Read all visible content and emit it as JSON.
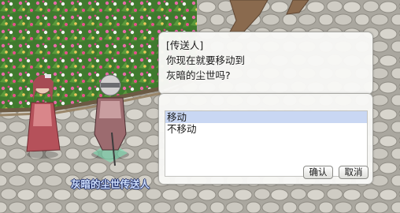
{
  "dialog": {
    "message_text": "[传送人]\n你现在就要移动到\n灰暗的尘世吗?",
    "options": [
      {
        "label": "移动",
        "selected": true
      },
      {
        "label": "不移动",
        "selected": false
      }
    ],
    "ok_label": "确认",
    "cancel_label": "取消"
  },
  "npc": {
    "name_label": "灰暗的尘世传送人"
  },
  "colors": {
    "selection_highlight": "#c9d7f3",
    "npc_label_text": "#cfe0ff",
    "npc_label_outline": "#1b2a66"
  }
}
